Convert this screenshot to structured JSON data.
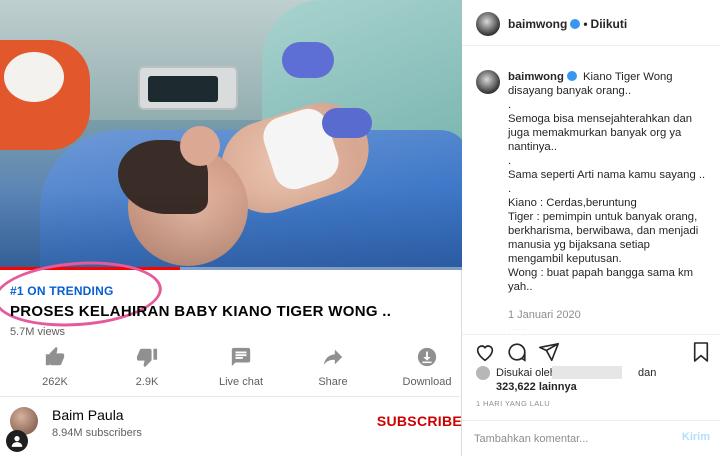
{
  "youtube": {
    "trending_label": "#1 ON TRENDING",
    "video_title": "PROSES KELAHIRAN BABY KIANO TIGER WONG ..",
    "views": "5.7M views",
    "progress": 0.39,
    "actions": [
      {
        "name": "like",
        "icon": "thumbs-up-icon",
        "label": "262K"
      },
      {
        "name": "dislike",
        "icon": "thumbs-down-icon",
        "label": "2.9K"
      },
      {
        "name": "live-chat",
        "icon": "chat-icon",
        "label": "Live chat"
      },
      {
        "name": "share",
        "icon": "share-icon",
        "label": "Share"
      },
      {
        "name": "download",
        "icon": "download-icon",
        "label": "Download"
      }
    ],
    "channel": {
      "name": "Baim Paula",
      "subscribers": "8.94M subscribers",
      "subscribe_label": "SUBSCRIBE"
    },
    "colors": {
      "accent": "#cc0000",
      "link": "#065fd4",
      "highlight_circle": "#e45a9b"
    }
  },
  "instagram": {
    "header": {
      "username": "baimwong",
      "follow_state": "Diikuti"
    },
    "caption": {
      "username": "baimwong",
      "lines": [
        "Kiano Tiger Wong",
        "disayang banyak orang..",
        ".",
        "Semoga bisa mensejahterahkan dan",
        "juga memakmurkan banyak org ya",
        "nantinya..",
        ".",
        "Sama seperti Arti nama kamu sayang ..",
        ".",
        "Kiano : Cerdas,beruntung",
        "Tiger : pemimpin untuk banyak orang,",
        "berkharisma, berwibawa, dan menjadi",
        "manusia yg bijaksana setiap",
        "mengambil keputusan.",
        "Wong : buat papah bangga sama km",
        "yah.."
      ],
      "date": "1 Januari 2020",
      "more": "......"
    },
    "likes": {
      "liked_by": "Disukai oleh",
      "and": "dan",
      "count": "323,622 lainnya"
    },
    "timestamp": "1 HARI YANG LALU",
    "comment": {
      "placeholder": "Tambahkan komentar...",
      "post_label": "Kirim"
    },
    "colors": {
      "verified": "#3897f0",
      "post_disabled": "#b2dffc"
    }
  }
}
